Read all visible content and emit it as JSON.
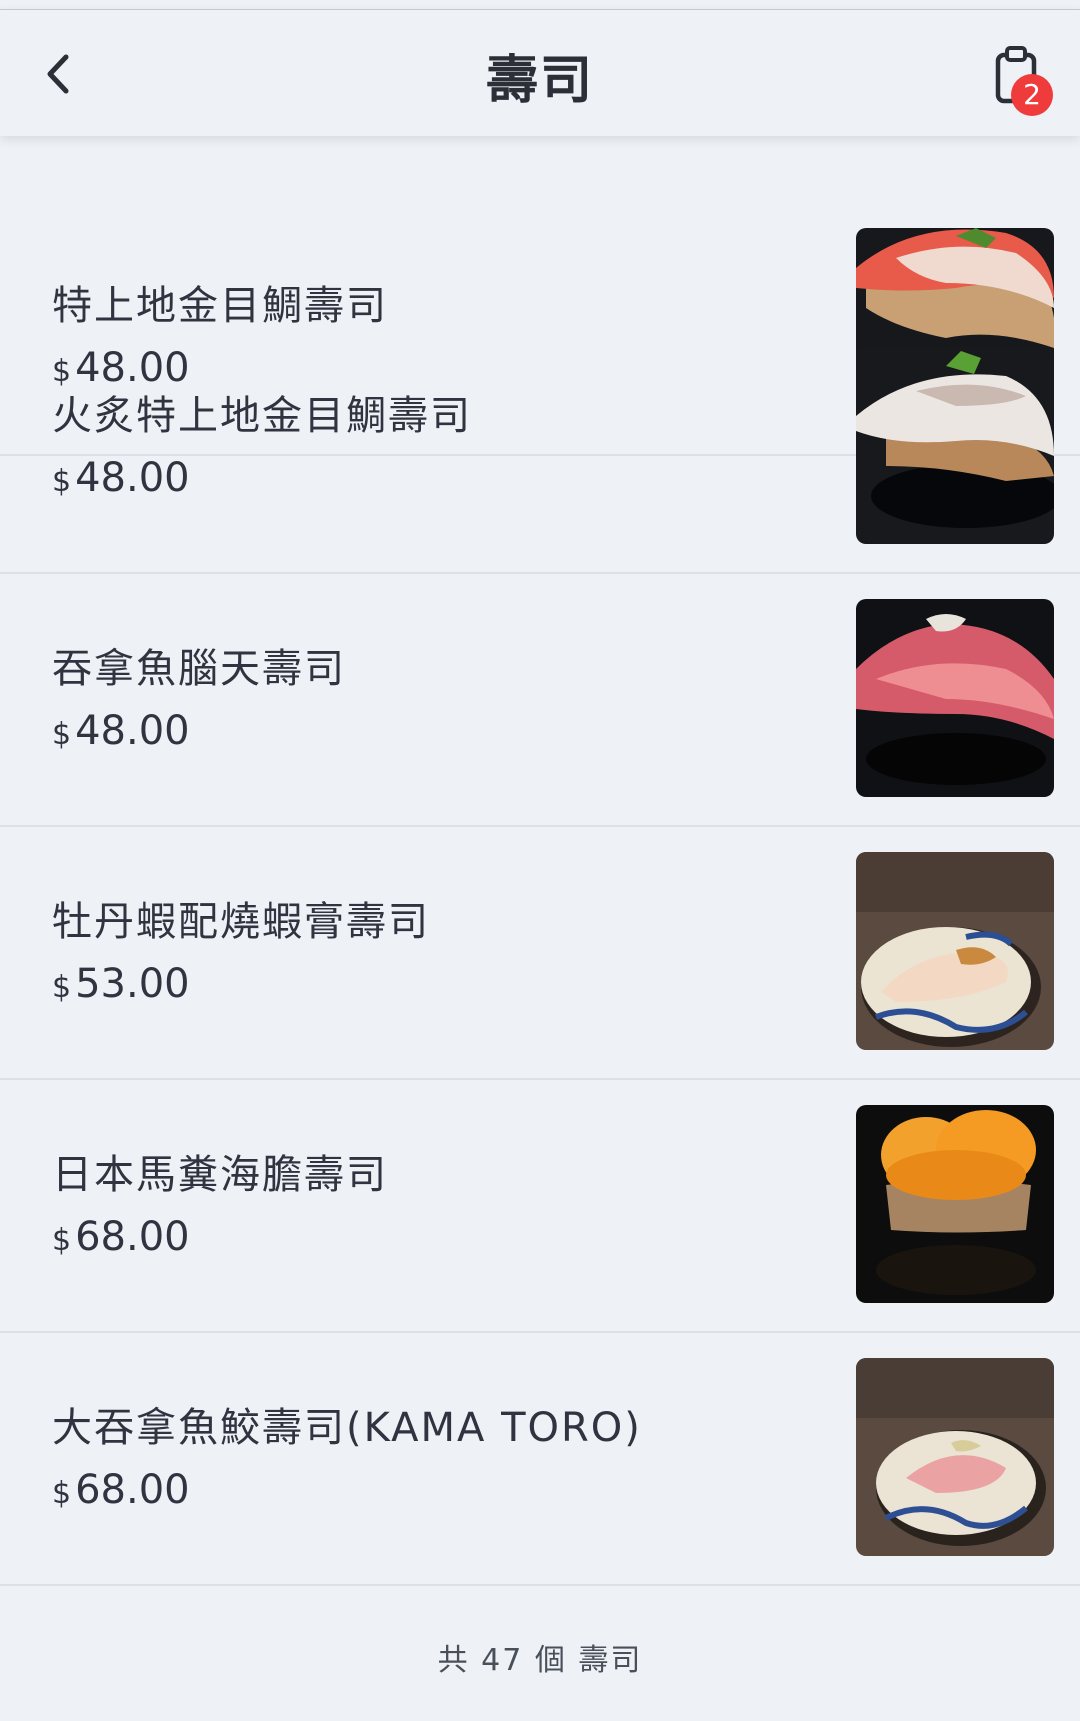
{
  "header": {
    "title": "壽司",
    "back_icon": "chevron-left-icon",
    "cart_icon": "clipboard-icon",
    "cart_count": "2"
  },
  "items": [
    {
      "name": "特上地金目鯛壽司",
      "currency": "$",
      "price": "48.00",
      "image": "sushi-kinmedai-photo"
    },
    {
      "name": "火炙特上地金目鯛壽司",
      "currency": "$",
      "price": "48.00",
      "image": "sushi-aburi-kinmedai-photo"
    },
    {
      "name": "吞拿魚腦天壽司",
      "currency": "$",
      "price": "48.00",
      "image": "sushi-tuna-noten-photo"
    },
    {
      "name": "牡丹蝦配燒蝦膏壽司",
      "currency": "$",
      "price": "53.00",
      "image": "sushi-botan-ebi-photo"
    },
    {
      "name": "日本馬糞海膽壽司",
      "currency": "$",
      "price": "68.00",
      "image": "sushi-bafun-uni-photo"
    },
    {
      "name": "大吞拿魚鮫壽司(KAMA TORO)",
      "currency": "$",
      "price": "68.00",
      "image": "sushi-kama-toro-photo"
    }
  ],
  "footer": {
    "total_text": "共 47 個 壽司"
  }
}
